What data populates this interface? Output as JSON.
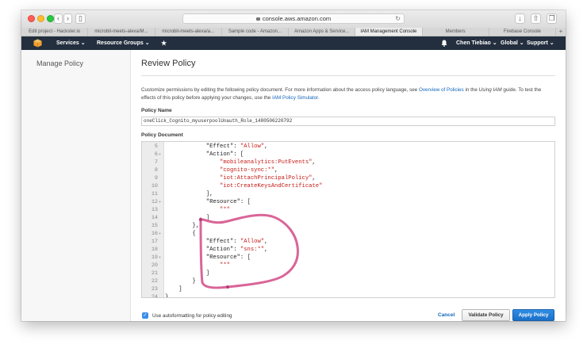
{
  "browser": {
    "url": "console.aws.amazon.com",
    "tabs": [
      {
        "label": "Edit project - Hackster.io",
        "active": false
      },
      {
        "label": "microbit-meets-alexa/M...",
        "active": false
      },
      {
        "label": "microbit-meets-alexa/a...",
        "active": false
      },
      {
        "label": "Sample code - Amazon...",
        "active": false
      },
      {
        "label": "Amazon Apps & Service...",
        "active": false
      },
      {
        "label": "IAM Management Console",
        "active": true
      },
      {
        "label": "Members",
        "active": false
      },
      {
        "label": "Firebase Console",
        "active": false
      }
    ],
    "new_tab": "+"
  },
  "nav": {
    "services": "Services",
    "resource_groups": "Resource Groups",
    "user": "Chen Tiebiao",
    "region": "Global",
    "support": "Support"
  },
  "sidebar": {
    "title": "Manage Policy"
  },
  "main": {
    "title": "Review Policy",
    "desc_1": "Customize permissions by editing the following policy document. For more information about the access policy language, see ",
    "desc_link_1": "Overview of Policies",
    "desc_2": " in the ",
    "desc_italic": "Using IAM",
    "desc_3": " guide. To test the effects of this policy before applying your changes, use the ",
    "desc_link_2": "IAM Policy Simulator",
    "desc_4": ".",
    "policy_name_label": "Policy Name",
    "policy_name_value": "oneClick_Cognito_myuserpoolUnauth_Role_1480506220792",
    "policy_document_label": "Policy Document"
  },
  "code_lines": [
    {
      "n": "5",
      "fold": false,
      "parts": [
        {
          "t": "            \"Effect\": ",
          "s": false
        },
        {
          "t": "\"Allow\"",
          "s": true
        },
        {
          "t": ",",
          "s": false
        }
      ]
    },
    {
      "n": "6",
      "fold": true,
      "parts": [
        {
          "t": "            \"Action\": [",
          "s": false
        }
      ]
    },
    {
      "n": "7",
      "fold": false,
      "parts": [
        {
          "t": "                ",
          "s": false
        },
        {
          "t": "\"mobileanalytics:PutEvents\"",
          "s": true
        },
        {
          "t": ",",
          "s": false
        }
      ]
    },
    {
      "n": "8",
      "fold": false,
      "parts": [
        {
          "t": "                ",
          "s": false
        },
        {
          "t": "\"cognito-sync:*\"",
          "s": true
        },
        {
          "t": ",",
          "s": false
        }
      ]
    },
    {
      "n": "9",
      "fold": false,
      "parts": [
        {
          "t": "                ",
          "s": false
        },
        {
          "t": "\"iot:AttachPrincipalPolicy\"",
          "s": true
        },
        {
          "t": ",",
          "s": false
        }
      ]
    },
    {
      "n": "10",
      "fold": false,
      "parts": [
        {
          "t": "                ",
          "s": false
        },
        {
          "t": "\"iot:CreateKeysAndCertificate\"",
          "s": true
        }
      ]
    },
    {
      "n": "11",
      "fold": false,
      "parts": [
        {
          "t": "            ],",
          "s": false
        }
      ]
    },
    {
      "n": "12",
      "fold": true,
      "parts": [
        {
          "t": "            \"Resource\": [",
          "s": false
        }
      ]
    },
    {
      "n": "13",
      "fold": false,
      "parts": [
        {
          "t": "                ",
          "s": false
        },
        {
          "t": "\"*\"",
          "s": true
        }
      ]
    },
    {
      "n": "14",
      "fold": false,
      "parts": [
        {
          "t": "            ]",
          "s": false
        }
      ]
    },
    {
      "n": "15",
      "fold": false,
      "parts": [
        {
          "t": "        },",
          "s": false
        }
      ]
    },
    {
      "n": "16",
      "fold": true,
      "parts": [
        {
          "t": "        {",
          "s": false
        }
      ]
    },
    {
      "n": "17",
      "fold": false,
      "parts": [
        {
          "t": "            \"Effect\": ",
          "s": false
        },
        {
          "t": "\"Allow\"",
          "s": true
        },
        {
          "t": ",",
          "s": false
        }
      ]
    },
    {
      "n": "18",
      "fold": false,
      "parts": [
        {
          "t": "            \"Action\": ",
          "s": false
        },
        {
          "t": "\"sns:*\"",
          "s": true
        },
        {
          "t": ",",
          "s": false
        }
      ]
    },
    {
      "n": "19",
      "fold": true,
      "parts": [
        {
          "t": "            \"Resource\": [",
          "s": false
        }
      ]
    },
    {
      "n": "20",
      "fold": false,
      "parts": [
        {
          "t": "                ",
          "s": false
        },
        {
          "t": "\"*\"",
          "s": true
        }
      ]
    },
    {
      "n": "21",
      "fold": false,
      "parts": [
        {
          "t": "            ]",
          "s": false
        }
      ]
    },
    {
      "n": "22",
      "fold": false,
      "parts": [
        {
          "t": "        }",
          "s": false
        }
      ]
    },
    {
      "n": "23",
      "fold": false,
      "parts": [
        {
          "t": "    ]",
          "s": false
        }
      ]
    },
    {
      "n": "24",
      "fold": false,
      "parts": [
        {
          "t": "}",
          "s": false
        }
      ]
    }
  ],
  "footer": {
    "autoformat_checked": true,
    "autoformat_label": "Use autoformatting for policy editing",
    "cancel": "Cancel",
    "validate": "Validate Policy",
    "apply": "Apply Policy"
  },
  "colors": {
    "aws_nav": "#232f3e",
    "link": "#1166bb",
    "json_string": "#c41a16",
    "apply_button": "#1c6fc8",
    "annotation_marker": "#d24a86"
  },
  "icons": [
    "aws-cube-icon",
    "pin-icon",
    "bell-icon",
    "lock-icon",
    "reload-icon",
    "download-icon",
    "share-icon",
    "tabs-icon",
    "back-icon",
    "forward-icon",
    "sidebar-icon"
  ]
}
